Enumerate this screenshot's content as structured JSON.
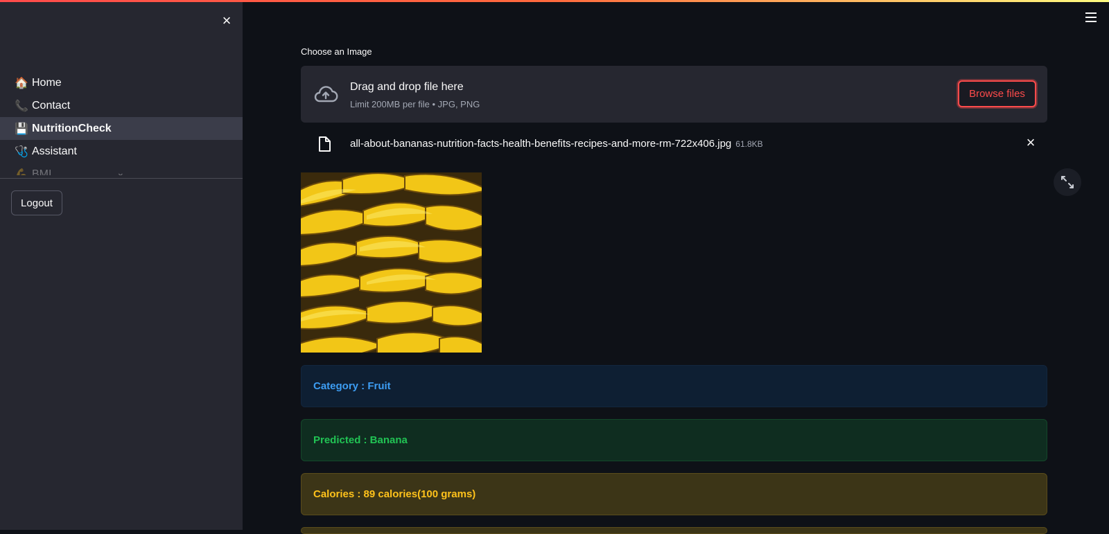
{
  "sidebar": {
    "nav": [
      {
        "label": "Home",
        "icon": "house-icon",
        "emoji": "🏠"
      },
      {
        "label": "Contact",
        "icon": "phone-icon",
        "emoji": "📞"
      },
      {
        "label": "NutritionCheck",
        "icon": "floppy-icon",
        "emoji": "💾"
      },
      {
        "label": "Assistant",
        "icon": "stethoscope-icon",
        "emoji": "🩺"
      },
      {
        "label": "BMI",
        "icon": "muscle-icon",
        "emoji": "💪"
      }
    ],
    "active_item": "NutritionCheck",
    "logout_label": "Logout"
  },
  "uploader": {
    "label": "Choose an Image",
    "drop_title": "Drag and drop file here",
    "drop_subtitle": "Limit 200MB per file • JPG, PNG",
    "browse_label": "Browse files",
    "file_name": "all-about-bananas-nutrition-facts-health-benefits-recipes-and-more-rm-722x406.jpg",
    "file_size": "61.8KB"
  },
  "results": {
    "category": "Category : Fruit",
    "predicted": "Predicted : Banana",
    "calories": "Calories : 89 calories(100 grams)"
  },
  "colors": {
    "accent": "#ff4b4b",
    "info": "#3d9df3",
    "success": "#21c354",
    "warning": "#ffc21b"
  }
}
